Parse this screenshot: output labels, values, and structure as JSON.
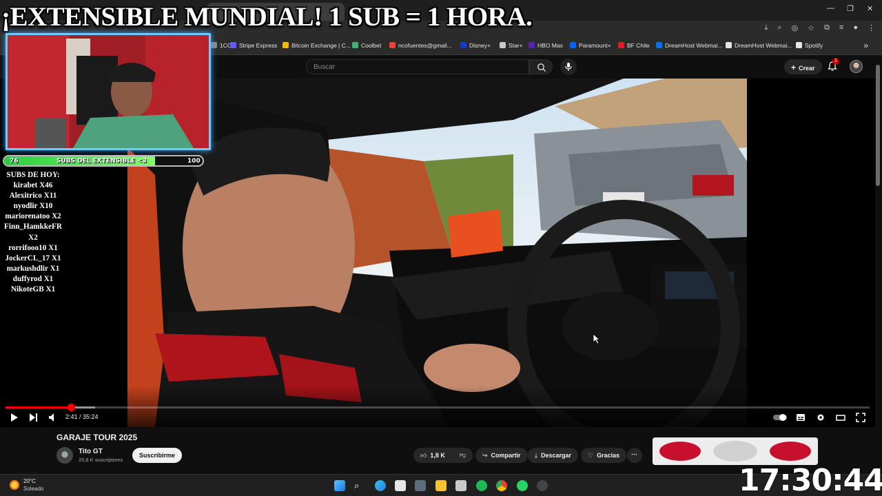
{
  "stream_overlay": {
    "title": "¡EXTENSIBLE MUNDIAL! 1 SUB = 1 HORA.",
    "subs_bar": {
      "start": "76",
      "label": "SUBS DEL EXTENSIBLE <3",
      "end": "100",
      "fill_fraction": 0.76,
      "color": "#2ecc40"
    },
    "subs_header": "SUBS DE HOY:",
    "subs_list": [
      "kirabet X46",
      "Alexitrico X11",
      "nyodlir X10",
      "mariorenatoo X2",
      "Finn_HamkkeFR X2",
      "rorrifooo10 X1",
      "JockerCL_17 X1",
      "markushdlir X1",
      "duffyrod X1",
      "NikoteGB X1"
    ],
    "webcam_border_color": "#6ec9ff"
  },
  "browser": {
    "bookmarks": [
      {
        "label": "1CO",
        "color": "#888888"
      },
      {
        "label": "Stripe Express",
        "color": "#635bff"
      },
      {
        "label": "Bitcoin Exchange | C...",
        "color": "#f0b90b"
      },
      {
        "label": "Coolbet",
        "color": "#3cb371"
      },
      {
        "label": "ncofuentes@gmail...",
        "color": "#ea4335"
      },
      {
        "label": "Disney+",
        "color": "#113ccf"
      },
      {
        "label": "Star+",
        "color": "#c8c8c8"
      },
      {
        "label": "HBO Max",
        "color": "#5822b4"
      },
      {
        "label": "Paramount+",
        "color": "#0064ff"
      },
      {
        "label": "BF Chile",
        "color": "#e31b23"
      },
      {
        "label": "DreamHost Webmai...",
        "color": "#0073ec"
      },
      {
        "label": "DreamHost Webmai...",
        "color": "#e6e6e6"
      },
      {
        "label": "Spotify",
        "color": "#e6e6e6"
      }
    ]
  },
  "youtube": {
    "search_placeholder": "Buscar",
    "create_label": "Crear",
    "notification_count": "1",
    "player": {
      "time": "2:41 / 35:24",
      "progress_fraction": 0.076,
      "buffer_fraction": 0.104
    },
    "video": {
      "title": "GARAJE TOUR 2025",
      "channel_name": "Tito GT",
      "channel_subs": "20,8 K suscriptores",
      "subscribe_label": "Suscribirme",
      "likes": "1,8 K",
      "share_label": "Compartir",
      "download_label": "Descargar",
      "thanks_label": "Gracias"
    }
  },
  "taskbar": {
    "temperature": "20°C",
    "weather": "Soleado",
    "clock": "17:30:44"
  },
  "colors": {
    "accent_red": "#ff0000",
    "background": "#0f0f0f"
  }
}
